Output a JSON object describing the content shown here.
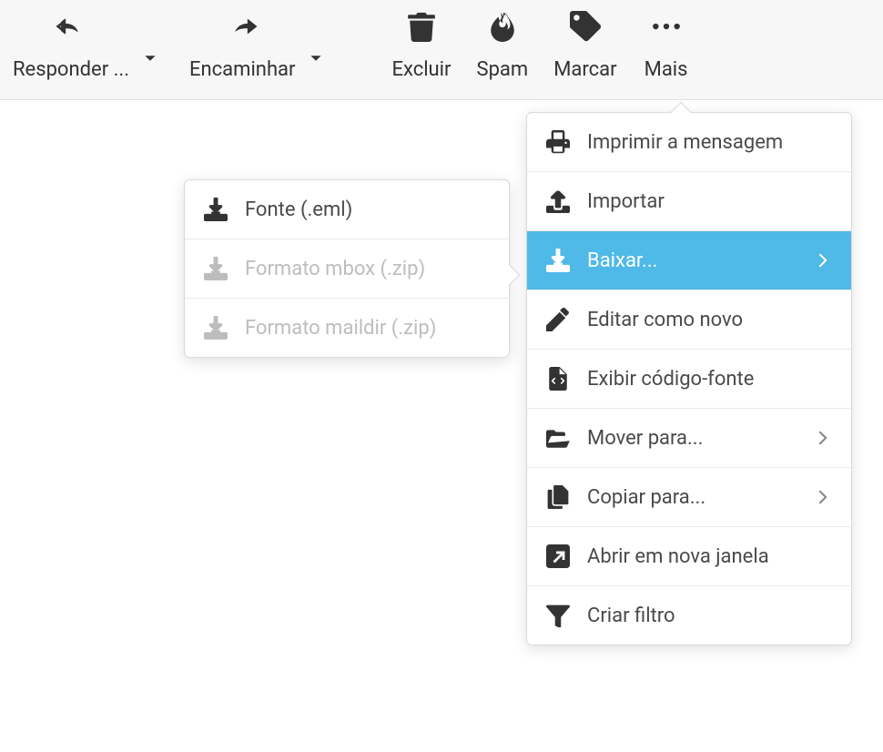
{
  "toolbar": {
    "reply": {
      "label": "Responder ..."
    },
    "forward": {
      "label": "Encaminhar"
    },
    "delete": {
      "label": "Excluir"
    },
    "spam": {
      "label": "Spam"
    },
    "mark": {
      "label": "Marcar"
    },
    "more": {
      "label": "Mais"
    }
  },
  "more_menu": {
    "print": {
      "label": "Imprimir a mensagem"
    },
    "import": {
      "label": "Importar"
    },
    "download": {
      "label": "Baixar..."
    },
    "edit_new": {
      "label": "Editar como novo"
    },
    "view_source": {
      "label": "Exibir código-fonte"
    },
    "move_to": {
      "label": "Mover para..."
    },
    "copy_to": {
      "label": "Copiar para..."
    },
    "open_new_window": {
      "label": "Abrir em nova janela"
    },
    "create_filter": {
      "label": "Criar filtro"
    }
  },
  "download_submenu": {
    "eml": {
      "label": "Fonte (.eml)"
    },
    "mbox": {
      "label": "Formato mbox (.zip)"
    },
    "maildir": {
      "label": "Formato maildir (.zip)"
    }
  }
}
